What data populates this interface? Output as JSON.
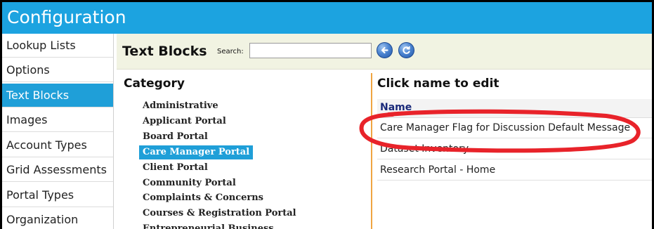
{
  "header": {
    "title": "Configuration"
  },
  "sidebar": {
    "items": [
      {
        "label": "Lookup Lists"
      },
      {
        "label": "Options"
      },
      {
        "label": "Text Blocks",
        "active": true
      },
      {
        "label": "Images"
      },
      {
        "label": "Account Types"
      },
      {
        "label": "Grid Assessments"
      },
      {
        "label": "Portal Types"
      },
      {
        "label": "Organization Types"
      }
    ]
  },
  "toolbar": {
    "title": "Text Blocks",
    "search_label": "Search:",
    "search_value": "",
    "back_icon": "arrow-left-icon",
    "refresh_icon": "refresh-icon"
  },
  "category": {
    "heading": "Category",
    "items": [
      {
        "label": "Administrative"
      },
      {
        "label": "Applicant Portal"
      },
      {
        "label": "Board Portal"
      },
      {
        "label": "Care Manager Portal",
        "selected": true
      },
      {
        "label": "Client Portal"
      },
      {
        "label": "Community Portal"
      },
      {
        "label": "Complaints & Concerns"
      },
      {
        "label": "Courses & Registration Portal"
      },
      {
        "label": "Entrepreneurial Business"
      }
    ]
  },
  "list": {
    "heading": "Click name to edit",
    "column_header": "Name",
    "rows": [
      {
        "name": "Care Manager Flag for Discussion Default Message"
      },
      {
        "name": "Dataset Inventory"
      },
      {
        "name": "Research Portal - Home"
      }
    ]
  },
  "colors": {
    "header_bg": "#1ca3e0",
    "active_bg": "#1f9fd8",
    "toolbar_bg": "#f1f3e2",
    "divider": "#f0a542",
    "annotation": "#e8232a"
  }
}
